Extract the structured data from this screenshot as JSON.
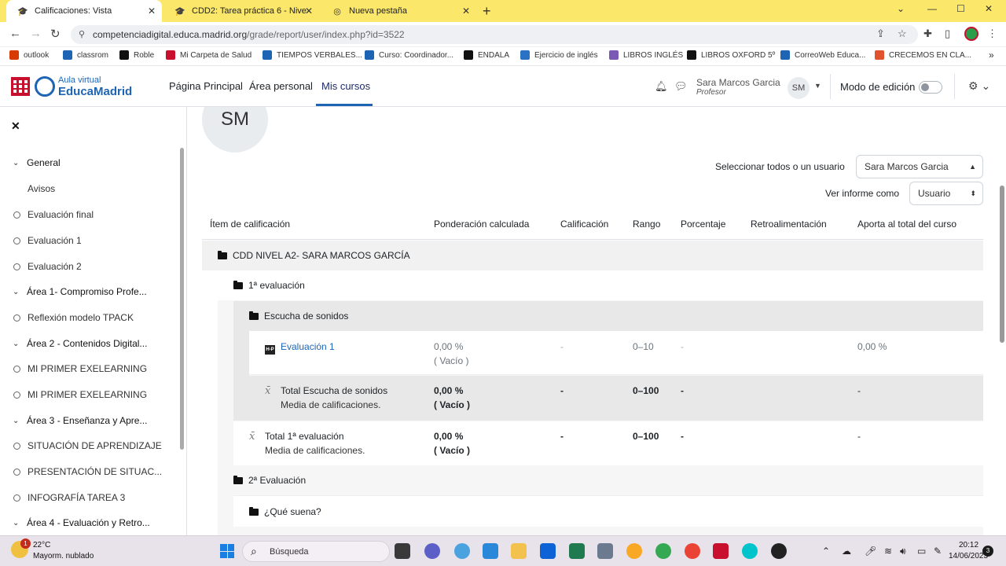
{
  "browser": {
    "tabs": [
      {
        "label": "Calificaciones: Vista",
        "active": true
      },
      {
        "label": "CDD2: Tarea práctica 6 - Nivel A2",
        "active": false
      },
      {
        "label": "Nueva pestaña",
        "active": false
      }
    ],
    "url_host": "competenciadigital.educa.madrid.org",
    "url_path": "/grade/report/user/index.php?id=3522",
    "bookmarks": [
      {
        "label": "outlook",
        "color": "#d83b01"
      },
      {
        "label": "classrom",
        "color": "#1e64b4"
      },
      {
        "label": "Roble",
        "color": "#111111"
      },
      {
        "label": "Mi Carpeta de Salud",
        "color": "#c8102e"
      },
      {
        "label": "TIEMPOS VERBALES...",
        "color": "#1e64b4"
      },
      {
        "label": "Curso: Coordinador...",
        "color": "#1e64b4"
      },
      {
        "label": "ENDALA",
        "color": "#111111"
      },
      {
        "label": "Ejercicio de inglés",
        "color": "#2a72c4"
      },
      {
        "label": "LIBROS INGLÉS",
        "color": "#7a5ab5"
      },
      {
        "label": "LIBROS OXFORD 5º",
        "color": "#111111"
      },
      {
        "label": "CorreoWeb Educa...",
        "color": "#1e64b4"
      },
      {
        "label": "CRECEMOS EN CLA...",
        "color": "#e0532c"
      }
    ]
  },
  "header": {
    "logo_line1": "Aula virtual",
    "logo_line2": "EducaMadrid",
    "nav": [
      "Página Principal",
      "Área personal",
      "Mis cursos"
    ],
    "user_name": "Sara Marcos Garcia",
    "user_role": "Profesor",
    "user_initials": "SM",
    "edit_mode_label": "Modo de edición"
  },
  "sidebar": {
    "items": [
      {
        "label": "General",
        "type": "section"
      },
      {
        "label": "Avisos",
        "type": "plain"
      },
      {
        "label": "Evaluación final",
        "type": "item"
      },
      {
        "label": "Evaluación 1",
        "type": "item"
      },
      {
        "label": "Evaluación 2",
        "type": "item"
      },
      {
        "label": "Área 1- Compromiso Profe...",
        "type": "section"
      },
      {
        "label": "Reflexión modelo TPACK",
        "type": "item"
      },
      {
        "label": "Área 2 - Contenidos Digital...",
        "type": "section"
      },
      {
        "label": "MI PRIMER EXELEARNING",
        "type": "item"
      },
      {
        "label": "MI PRIMER EXELEARNING",
        "type": "item"
      },
      {
        "label": "Área 3 - Enseñanza y Apre...",
        "type": "section"
      },
      {
        "label": "SITUACIÓN DE APRENDIZAJE",
        "type": "item"
      },
      {
        "label": "PRESENTACIÓN DE SITUAC...",
        "type": "item"
      },
      {
        "label": "INFOGRAFÍA TAREA 3",
        "type": "item"
      },
      {
        "label": "Área 4 - Evaluación y Retro...",
        "type": "section"
      }
    ]
  },
  "report": {
    "avatar_initials": "SM",
    "select_user_label": "Seleccionar todos o un usuario",
    "select_user_value": "Sara Marcos Garcia",
    "view_as_label": "Ver informe como",
    "view_as_value": "Usuario",
    "columns": [
      "Ítem de calificación",
      "Ponderación calculada",
      "Calificación",
      "Rango",
      "Porcentaje",
      "Retroalimentación",
      "Aporta al total del curso"
    ],
    "course": "CDD NIVEL A2- SARA MARCOS GARCÍA",
    "cat1": "1ª evaluación",
    "subcat1": "Escucha de sonidos",
    "item1": {
      "name": "Evaluación 1",
      "weight": "0,00 %",
      "weight_sub": "( Vacío )",
      "grade": "-",
      "range": "0–10",
      "percent": "-",
      "contrib": "0,00 %"
    },
    "total1": {
      "name": "Total Escucha de sonidos",
      "sub": "Media de calificaciones.",
      "weight": "0,00 %",
      "weight_sub": "( Vacío )",
      "grade": "-",
      "range": "0–100",
      "percent": "-",
      "contrib": "-"
    },
    "total2": {
      "name": "Total 1ª evaluación",
      "sub": "Media de calificaciones.",
      "weight": "0,00 %",
      "weight_sub": "( Vacío )",
      "grade": "-",
      "range": "0–100",
      "percent": "-",
      "contrib": "-"
    },
    "cat2": "2ª Evaluación",
    "subcat2": "¿Qué suena?"
  },
  "taskbar": {
    "temp": "22°C",
    "weather": "Mayorm. nublado",
    "weather_badge": "1",
    "search": "Búsqueda",
    "time": "20:12",
    "date": "14/06/2023",
    "notifications": "3"
  }
}
